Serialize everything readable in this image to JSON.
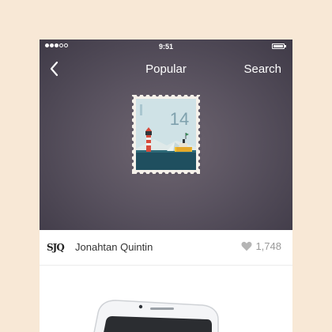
{
  "status_bar": {
    "time": "9:51",
    "signal_dots_filled": 3,
    "signal_dots_total": 5
  },
  "nav": {
    "title": "Popular",
    "search_label": "Search",
    "back_icon": "chevron-left-icon"
  },
  "stamp": {
    "number": "14"
  },
  "post": {
    "avatar_text": "SJQ",
    "author": "Jonahtan Quintin",
    "likes": "1,748",
    "like_icon": "heart-icon"
  },
  "colors": {
    "background": "#f8e8d6",
    "hero": "#5a5360",
    "like_gray": "#9a9a9a"
  }
}
